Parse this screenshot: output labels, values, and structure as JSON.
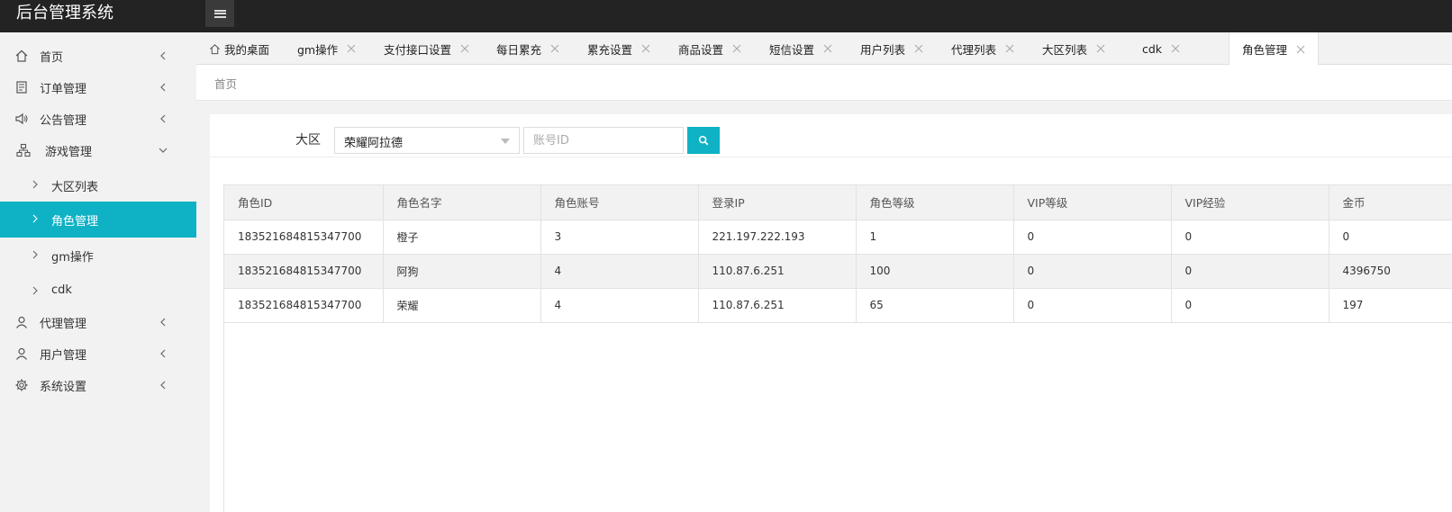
{
  "app": {
    "title": "后台管理系统"
  },
  "sidebar": {
    "items": [
      {
        "label": "首页",
        "icon": "home-icon"
      },
      {
        "label": "订单管理",
        "icon": "document-icon"
      },
      {
        "label": "公告管理",
        "icon": "speaker-icon"
      },
      {
        "label": "游戏管理",
        "icon": "sitemap-icon"
      },
      {
        "label": "代理管理",
        "icon": "user-icon"
      },
      {
        "label": "用户管理",
        "icon": "user-icon"
      },
      {
        "label": "系统设置",
        "icon": "gear-icon"
      }
    ],
    "game_sub": [
      {
        "label": "大区列表"
      },
      {
        "label": "角色管理"
      },
      {
        "label": "gm操作"
      },
      {
        "label": "cdk"
      }
    ]
  },
  "tabs": [
    {
      "label": "我的桌面"
    },
    {
      "label": "gm操作"
    },
    {
      "label": "支付接口设置"
    },
    {
      "label": "每日累充"
    },
    {
      "label": "累充设置"
    },
    {
      "label": "商品设置"
    },
    {
      "label": "短信设置"
    },
    {
      "label": "用户列表"
    },
    {
      "label": "代理列表"
    },
    {
      "label": "大区列表"
    },
    {
      "label": "cdk"
    },
    {
      "label": "角色管理"
    }
  ],
  "breadcrumb": "首页",
  "filter": {
    "region_label": "大区",
    "region_value": "荣耀阿拉德",
    "account_placeholder": "账号ID"
  },
  "table": {
    "headers": [
      "角色ID",
      "角色名字",
      "角色账号",
      "登录IP",
      "角色等级",
      "VIP等级",
      "VIP经验",
      "金币"
    ],
    "rows": [
      [
        "183521684815347700",
        "橙子",
        "3",
        "221.197.222.193",
        "1",
        "0",
        "0",
        "0"
      ],
      [
        "183521684815347700",
        "阿狗",
        "4",
        "110.87.6.251",
        "100",
        "0",
        "0",
        "4396750"
      ],
      [
        "183521684815347700",
        "荣耀",
        "4",
        "110.87.6.251",
        "65",
        "0",
        "0",
        "197"
      ]
    ]
  },
  "colors": {
    "accent": "#0fb2c5",
    "topbar": "#232323"
  }
}
